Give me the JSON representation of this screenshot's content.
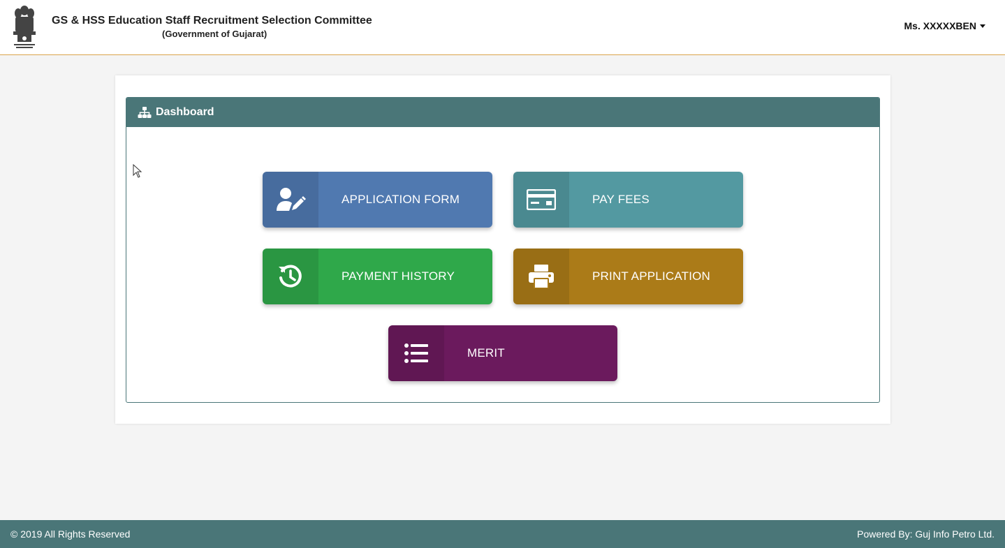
{
  "header": {
    "title": "GS & HSS Education Staff Recruitment Selection Committee",
    "subtitle": "(Government of Gujarat)",
    "emblem_icon": "national-emblem-icon",
    "user_name": "Ms. XXXXXBEN"
  },
  "dashboard": {
    "heading": "Dashboard",
    "heading_icon": "sitemap-icon",
    "tiles": [
      {
        "label": "APPLICATION FORM",
        "icon": "user-edit-icon",
        "color": "#5079b0"
      },
      {
        "label": "PAY FEES",
        "icon": "money-card-icon",
        "color": "#5399a1"
      },
      {
        "label": "PAYMENT HISTORY",
        "icon": "history-icon",
        "color": "#2fa84a"
      },
      {
        "label": "PRINT APPLICATION",
        "icon": "printer-icon",
        "color": "#ab7b18"
      },
      {
        "label": "MERIT",
        "icon": "list-icon",
        "color": "#6b1a5d"
      }
    ]
  },
  "footer": {
    "copyright": "© 2019 All Rights Reserved",
    "powered_by": "Powered By: Guj Info Petro Ltd."
  },
  "colors": {
    "theme": "#4a7678",
    "header_border": "#d9a44a",
    "background": "#f4f4f4"
  }
}
